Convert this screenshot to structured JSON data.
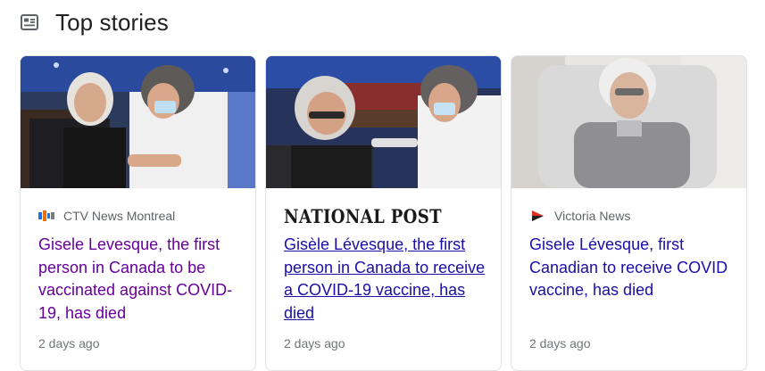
{
  "section": {
    "title": "Top stories",
    "icon": "news-icon"
  },
  "stories": [
    {
      "image": "photo of elderly woman receiving vaccine from nurse with face mask",
      "source": "CTV News Montreal",
      "source_icon": "ctv-news-favicon",
      "headline": "Gisele Levesque, the first person in Canada to be vaccinated against COVID-19, has died",
      "time": "2 days ago"
    },
    {
      "image": "photo of elderly woman getting injection in arm by masked nurse",
      "source": "NATIONAL POST",
      "source_icon": "national-post-logo",
      "headline": "Gisèle Lévesque, the first person in Canada to receive a COVID-19 vaccine, has died",
      "time": "2 days ago"
    },
    {
      "image": "photo of elderly woman in grey cardigan seated in armchair",
      "source": "Victoria News",
      "source_icon": "victoria-news-favicon",
      "headline": "Gisele Lévesque, first Canadian to receive COVID vaccine, has died",
      "time": "2 days ago"
    }
  ],
  "colors": {
    "link": "#1a0dab",
    "visited": "#660099",
    "meta": "#70757a",
    "border": "#dfe1e5"
  }
}
